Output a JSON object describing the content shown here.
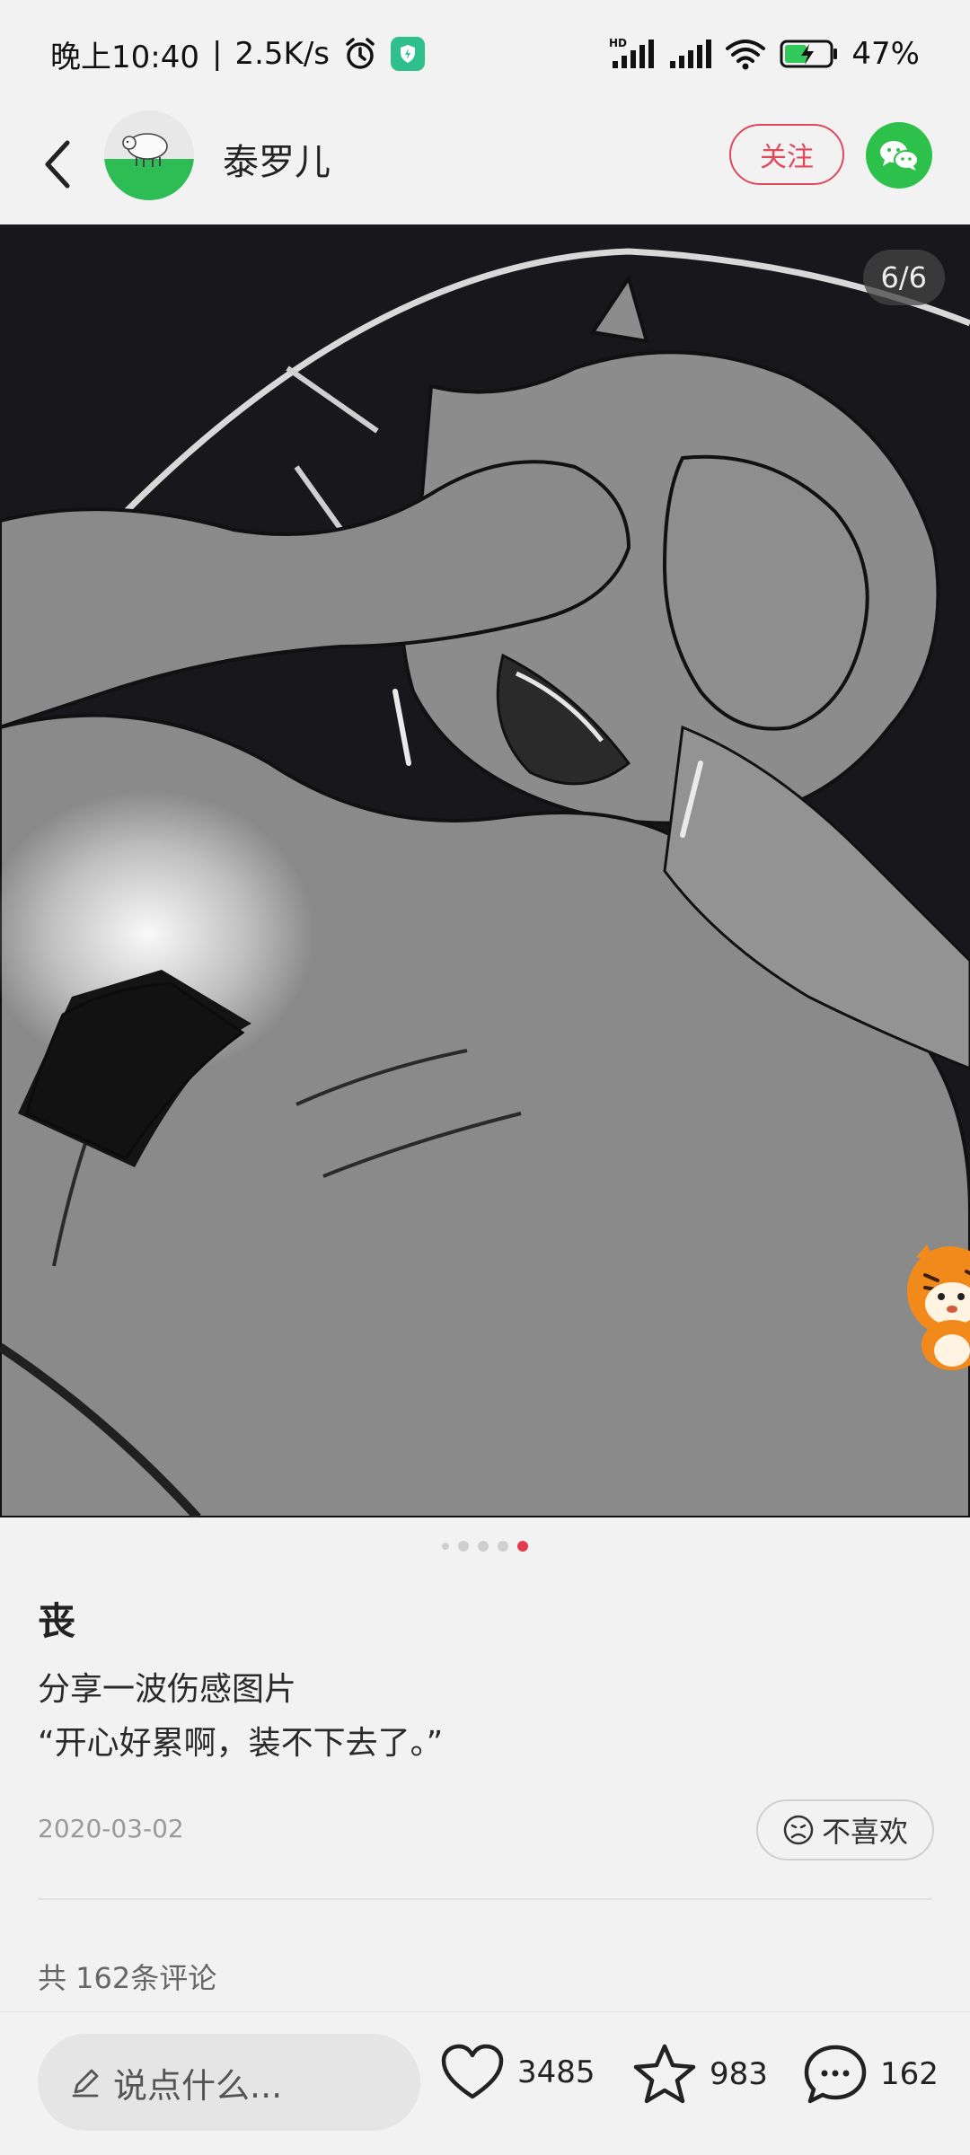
{
  "status_bar": {
    "time": "晚上10:40",
    "speed": "2.5K/s",
    "battery": "47%",
    "hd_label": "HD"
  },
  "header": {
    "username": "泰罗儿",
    "follow_label": "关注"
  },
  "image": {
    "counter": "6/6",
    "total": 6,
    "current": 6
  },
  "post": {
    "title": "丧",
    "line1": "分享一波伤感图片",
    "line2": "“开心好累啊，装不下去了。”",
    "date": "2020-03-02",
    "dislike_label": "不喜欢"
  },
  "comments": {
    "count_label": "共 162条评论"
  },
  "bottom_bar": {
    "input_placeholder": "说点什么...",
    "likes": "3485",
    "favorites": "983",
    "comments": "162"
  },
  "colors": {
    "accent": "#e33b52",
    "wechat": "#2dc04a",
    "shield": "#2fbf8c"
  },
  "icons": [
    "back-icon",
    "alarm-icon",
    "shield-icon",
    "signal-icon",
    "wifi-icon",
    "battery-icon",
    "wechat-icon",
    "sad-face-icon",
    "pencil-icon",
    "heart-icon",
    "star-icon",
    "comment-bubble-icon"
  ]
}
